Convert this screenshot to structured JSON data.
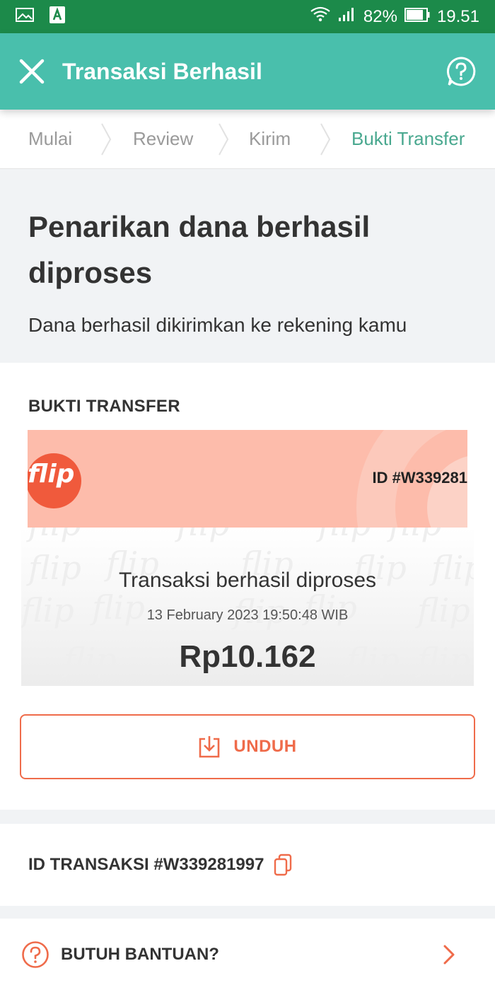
{
  "status_bar": {
    "battery": "82%",
    "time": "19.51"
  },
  "app_bar": {
    "title": "Transaksi Berhasil"
  },
  "stepper": {
    "steps": [
      "Mulai",
      "Review",
      "Kirim",
      "Bukti Transfer"
    ]
  },
  "header": {
    "title_line1": "Penarikan dana berhasil",
    "title_line2": "diproses",
    "subtitle": "Dana berhasil dikirimkan ke rekening kamu"
  },
  "bukti": {
    "label": "BUKTI TRANSFER",
    "receipt": {
      "brand": "flip",
      "id": "ID #W339281",
      "title": "Transaksi berhasil diproses",
      "date": "13 February 2023 19:50:48 WIB",
      "amount": "Rp10.162"
    },
    "download_label": "UNDUH"
  },
  "transaction": {
    "id_text": "ID TRANSAKSI #W339281997"
  },
  "help": {
    "label": "BUTUH BANTUAN?"
  },
  "colors": {
    "status_bar": "#1c8a4a",
    "app_bar": "#49bfac",
    "accent": "#ef6b4a",
    "active_step": "#49a88f"
  },
  "icons": [
    "gallery-icon",
    "a-app-icon",
    "wifi-icon",
    "signal-icon",
    "battery-icon",
    "close-icon",
    "help-chat-icon",
    "download-icon",
    "copy-icon",
    "question-circle-icon",
    "chevron-right-icon"
  ]
}
